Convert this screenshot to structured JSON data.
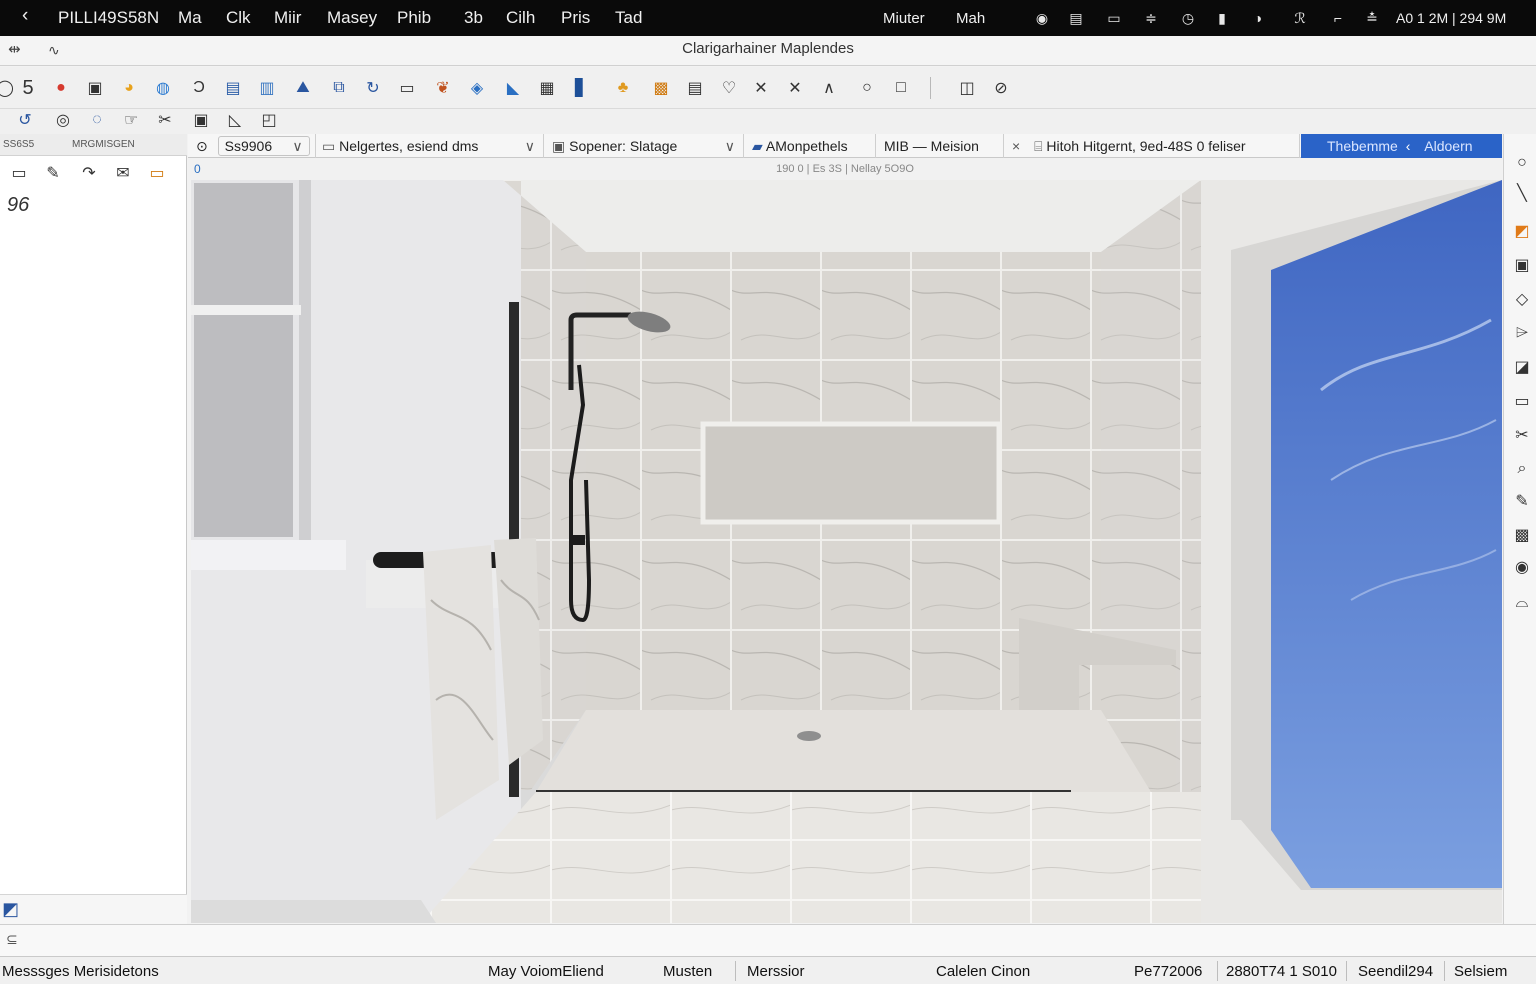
{
  "menubar": {
    "back_glyph": "‹",
    "app_name": "PILLI49S58N",
    "items": [
      "Ma",
      "Clk",
      "Miir",
      "Masey",
      "Phib",
      "3b",
      "Cilh",
      "Pris",
      "Tad"
    ],
    "right_items": [
      "Miuter",
      "Mah"
    ],
    "clock": "A0 1 2M | 294 9M"
  },
  "titlebar": {
    "title": "Clarigarhainer Maplendes"
  },
  "left_panel": {
    "header_left": "SS6S5",
    "header_right": "MRGMISGEN",
    "value": "96"
  },
  "tabs": [
    {
      "label": "Ss9906",
      "prefix": "⊙",
      "chev": "∨"
    },
    {
      "label": "Nelgertes, esiend dms",
      "chev": "∨"
    },
    {
      "label": "Sopener: Slatage",
      "chev": "∨"
    },
    {
      "label": "AMonpethels"
    },
    {
      "label": "MIB — Meision"
    },
    {
      "label": "Hitoh Hitgernt, 9ed-48S 0 feliser",
      "close": "×"
    }
  ],
  "active_tab": {
    "label": "Thebemme",
    "sublabel": "Aldoern"
  },
  "info_line": "190 0 | Es 3S | Nellay 5O9O",
  "viewport": {
    "corner_badge": "0"
  },
  "statusbar": {
    "messages": "Messsges Merisidetons",
    "fields": [
      "May VoiomEliend",
      "Musten",
      "Merssior",
      "Calelen Cinon",
      "Pe772006",
      "2880T74 1 S010",
      "Seendil294",
      "Selsiem"
    ]
  },
  "colors": {
    "menubar_bg": "#0a0a0a",
    "active_tab": "#2a63c8",
    "sky": "#5f87d6",
    "marble": "#d7d4cf"
  }
}
